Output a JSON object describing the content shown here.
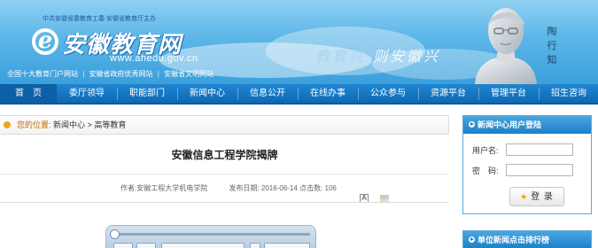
{
  "banner": {
    "tagline": "中共安徽省委教育工委  安徽省教育厅主办",
    "site_name": "安徽教育网",
    "domain": "www.ahedu.gov.cn",
    "motto_a": "教育兴",
    "motto_b": "则安徽兴",
    "sub_links": [
      {
        "label": "全国十大教育门户网站"
      },
      {
        "label": "安徽省政府优秀网站"
      },
      {
        "label": "安徽省文明网站"
      }
    ],
    "sep": "|",
    "portrait_name": "陶行知"
  },
  "nav": {
    "items": [
      {
        "label": "首　页"
      },
      {
        "label": "委厅领导"
      },
      {
        "label": "职能部门"
      },
      {
        "label": "新闻中心"
      },
      {
        "label": "信息公开"
      },
      {
        "label": "在线办事"
      },
      {
        "label": "公众参与"
      },
      {
        "label": "资源平台"
      },
      {
        "label": "管理平台"
      },
      {
        "label": "招生咨询"
      }
    ]
  },
  "breadcrumb": {
    "prefix": "您的位置:",
    "level1": "新闻中心",
    "separator": ">",
    "level2": "高等教育"
  },
  "article": {
    "title": "安徽信息工程学院揭牌",
    "author": "作者:安徽工程大学机电学院",
    "date": "发布日期: 2016-06-14",
    "views": "点击数: 106",
    "font_toggle": "A"
  },
  "sidebar": {
    "login_title": "新闻中心用户登陆",
    "username_label": "用户名:",
    "password_label": "密　码:",
    "username_value": "",
    "password_value": "",
    "login_button": "登 录",
    "rank_title": "单位新闻点击排行榜"
  },
  "colors": {
    "nav_blue": "#0f69b4",
    "banner_sky": "#5cb6e8",
    "panel_blue": "#1c7fc6",
    "breadcrumb_prefix": "#c06b00"
  }
}
